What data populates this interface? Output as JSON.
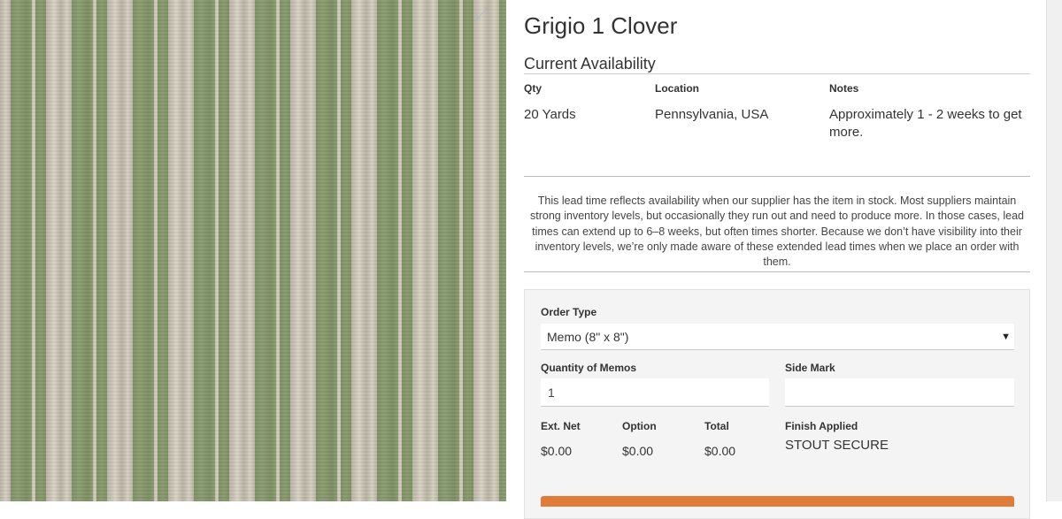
{
  "product": {
    "title": "Grigio 1 Clover",
    "swatch_colors": [
      "#7d9064",
      "#c8c2b3"
    ]
  },
  "availability": {
    "heading": "Current Availability",
    "columns": {
      "qty": "Qty",
      "location": "Location",
      "notes": "Notes"
    },
    "row": {
      "qty": "20 Yards",
      "location": "Pennsylvania, USA",
      "notes": "Approximately 1 - 2 weeks to get more."
    },
    "lead_time_notice": "This lead time reflects availability when our supplier has the item in stock. Most suppliers maintain strong inventory levels, but occasionally they run out and need to produce more. In those cases, lead times can extend up to 6–8 weeks, but often times shorter. Because we don’t have visibility into their inventory levels, we’re only made aware of these extended lead times when we place an order with them."
  },
  "order_form": {
    "order_type_label": "Order Type",
    "order_type_value": "Memo (8\" x 8\")",
    "quantity_label": "Quantity of Memos",
    "quantity_value": "1",
    "side_mark_label": "Side Mark",
    "side_mark_value": "",
    "ext_net_label": "Ext. Net",
    "ext_net_value": "$0.00",
    "option_label": "Option",
    "option_value": "$0.00",
    "total_label": "Total",
    "total_value": "$0.00",
    "finish_label": "Finish Applied",
    "finish_value": "STOUT SECURE",
    "accent_color": "#e07b39"
  },
  "icons": {
    "expand": "expand-icon",
    "dropdown": "caret-down-icon"
  }
}
